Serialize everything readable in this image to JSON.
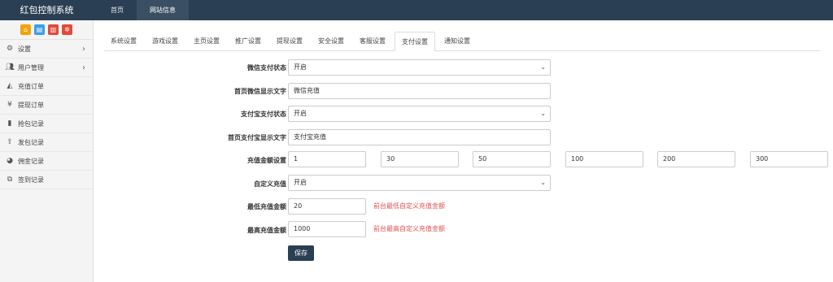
{
  "app": {
    "title": "红包控制系统"
  },
  "topnav": [
    {
      "label": "首页"
    },
    {
      "label": "网站信息"
    }
  ],
  "shortcuts": [
    {
      "icon": "home-icon",
      "color": "#f0a30a"
    },
    {
      "icon": "document-icon",
      "color": "#3a9ee8"
    },
    {
      "icon": "trash-icon",
      "color": "#e04a3a"
    },
    {
      "icon": "settings-icon",
      "color": "#e04a3a"
    }
  ],
  "sidebar": {
    "items": [
      {
        "label": "设置",
        "icon": "gears-icon"
      },
      {
        "label": "用户管理",
        "icon": "users-icon"
      },
      {
        "label": "充值订单",
        "icon": "area-chart-icon"
      },
      {
        "label": "提现订单",
        "icon": "yen-icon"
      },
      {
        "label": "抢包记录",
        "icon": "bar-chart-icon"
      },
      {
        "label": "发包记录",
        "icon": "upload-icon"
      },
      {
        "label": "佣金记录",
        "icon": "pie-chart-icon"
      },
      {
        "label": "签到记录",
        "icon": "clone-icon"
      }
    ]
  },
  "tabs": [
    {
      "label": "系统设置"
    },
    {
      "label": "游戏设置"
    },
    {
      "label": "主页设置"
    },
    {
      "label": "推广设置"
    },
    {
      "label": "提现设置"
    },
    {
      "label": "安全设置"
    },
    {
      "label": "客服设置"
    },
    {
      "label": "支付设置"
    },
    {
      "label": "通知设置"
    }
  ],
  "active_tab": "支付设置",
  "form": {
    "wechat_status": {
      "label": "微信支付状态",
      "value": "开启"
    },
    "wechat_text": {
      "label": "首页微信显示文字",
      "value": "微信充值"
    },
    "alipay_status": {
      "label": "支付宝支付状态",
      "value": "开启"
    },
    "alipay_text": {
      "label": "首页支付宝显示文字",
      "value": "支付宝充值"
    },
    "amounts": {
      "label": "充值金额设置",
      "values": [
        "1",
        "30",
        "50",
        "100",
        "200",
        "300"
      ]
    },
    "custom": {
      "label": "自定义充值",
      "value": "开启"
    },
    "min_amount": {
      "label": "最低充值金额",
      "value": "20",
      "hint": "前台最低自定义充值金额"
    },
    "max_amount": {
      "label": "最高充值金额",
      "value": "1000",
      "hint": "前台最高自定义充值金额"
    },
    "save_label": "保存"
  },
  "colors": {
    "topbar": "#2a3f54",
    "hint": "#e34f4f"
  }
}
